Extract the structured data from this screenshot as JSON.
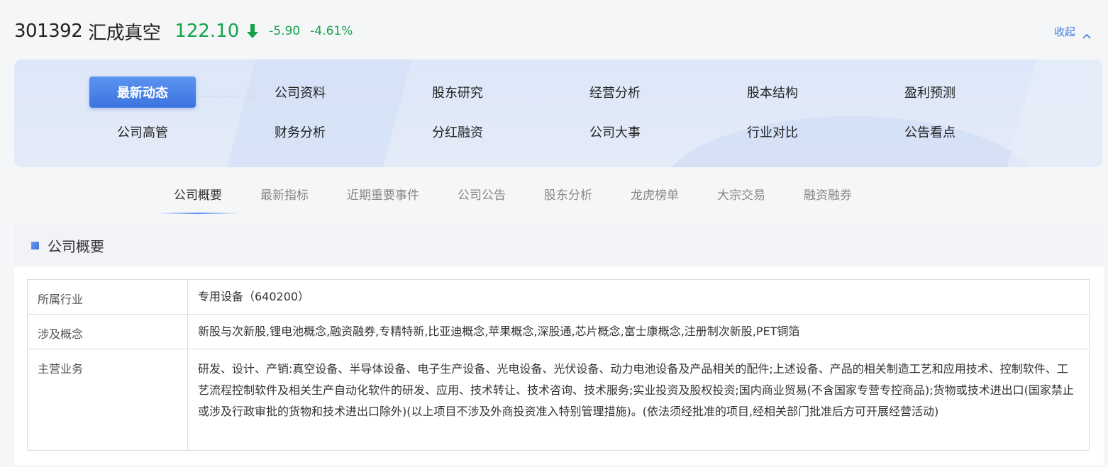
{
  "header": {
    "code": "301392",
    "name": "汇成真空",
    "price": "122.10",
    "change": "-5.90",
    "change_pct": "-4.61%",
    "collapse_label": "收起",
    "trend_icon": "arrow-down-icon",
    "colors": {
      "down": "#16a34a",
      "link": "#3b7ddd"
    }
  },
  "nav": {
    "items": [
      "最新动态",
      "公司资料",
      "股东研究",
      "经营分析",
      "股本结构",
      "盈利预测",
      "公司高管",
      "财务分析",
      "分红融资",
      "公司大事",
      "行业对比",
      "公告看点"
    ],
    "active": "最新动态",
    "accent": "#3d74e0"
  },
  "subtabs": {
    "items": [
      "公司概要",
      "最新指标",
      "近期重要事件",
      "公司公告",
      "股东分析",
      "龙虎榜单",
      "大宗交易",
      "融资融券"
    ],
    "active": "公司概要"
  },
  "section": {
    "title": "公司概要",
    "rows": [
      {
        "label": "所属行业",
        "value": "专用设备（640200）"
      },
      {
        "label": "涉及概念",
        "value": "新股与次新股,锂电池概念,融资融券,专精特新,比亚迪概念,苹果概念,深股通,芯片概念,富士康概念,注册制次新股,PET铜箔"
      },
      {
        "label": "主营业务",
        "value": "研发、设计、产销:真空设备、半导体设备、电子生产设备、光电设备、光伏设备、动力电池设备及产品相关的配件;上述设备、产品的相关制造工艺和应用技术、控制软件、工艺流程控制软件及相关生产自动化软件的研发、应用、技术转让、技术咨询、技术服务;实业投资及股权投资;国内商业贸易(不含国家专营专控商品);货物或技术进出口(国家禁止或涉及行政审批的货物和技术进出口除外)(以上项目不涉及外商投资准入特别管理措施)。(依法须经批准的项目,经相关部门批准后方可开展经营活动)"
      }
    ]
  }
}
